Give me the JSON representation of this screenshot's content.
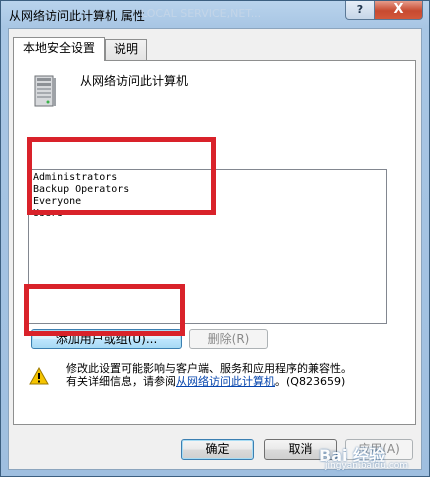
{
  "window": {
    "title": "从网络访问此计算机 属性",
    "ghost_text": "LOCAL SERVICE,NET...",
    "help_glyph": "?",
    "close_glyph": "X"
  },
  "tabs": [
    {
      "label": "本地安全设置",
      "active": true
    },
    {
      "label": "说明",
      "active": false
    }
  ],
  "policy": {
    "icon": "server-icon",
    "title": "从网络访问此计算机"
  },
  "members": [
    "Administrators",
    "Backup Operators",
    "Everyone",
    "Users"
  ],
  "buttons": {
    "add": "添加用户或组(U)...",
    "remove": "删除(R)",
    "ok": "确定",
    "cancel": "取消",
    "apply": "应用(A)"
  },
  "warning": {
    "icon": "warning-icon",
    "line1": "修改此设置可能影响与客户端、服务和应用程序的兼容性。",
    "line2_prefix": "有关详细信息，请参阅",
    "link_text": "从网络访问此计算机",
    "line2_suffix": "。(Q823659)"
  },
  "watermark": {
    "logo": "Bai 经验",
    "url": "jingyan.baidu.com"
  },
  "colors": {
    "annotation": "#d9222a",
    "link": "#0645ad",
    "close_button": "#c74a30"
  }
}
